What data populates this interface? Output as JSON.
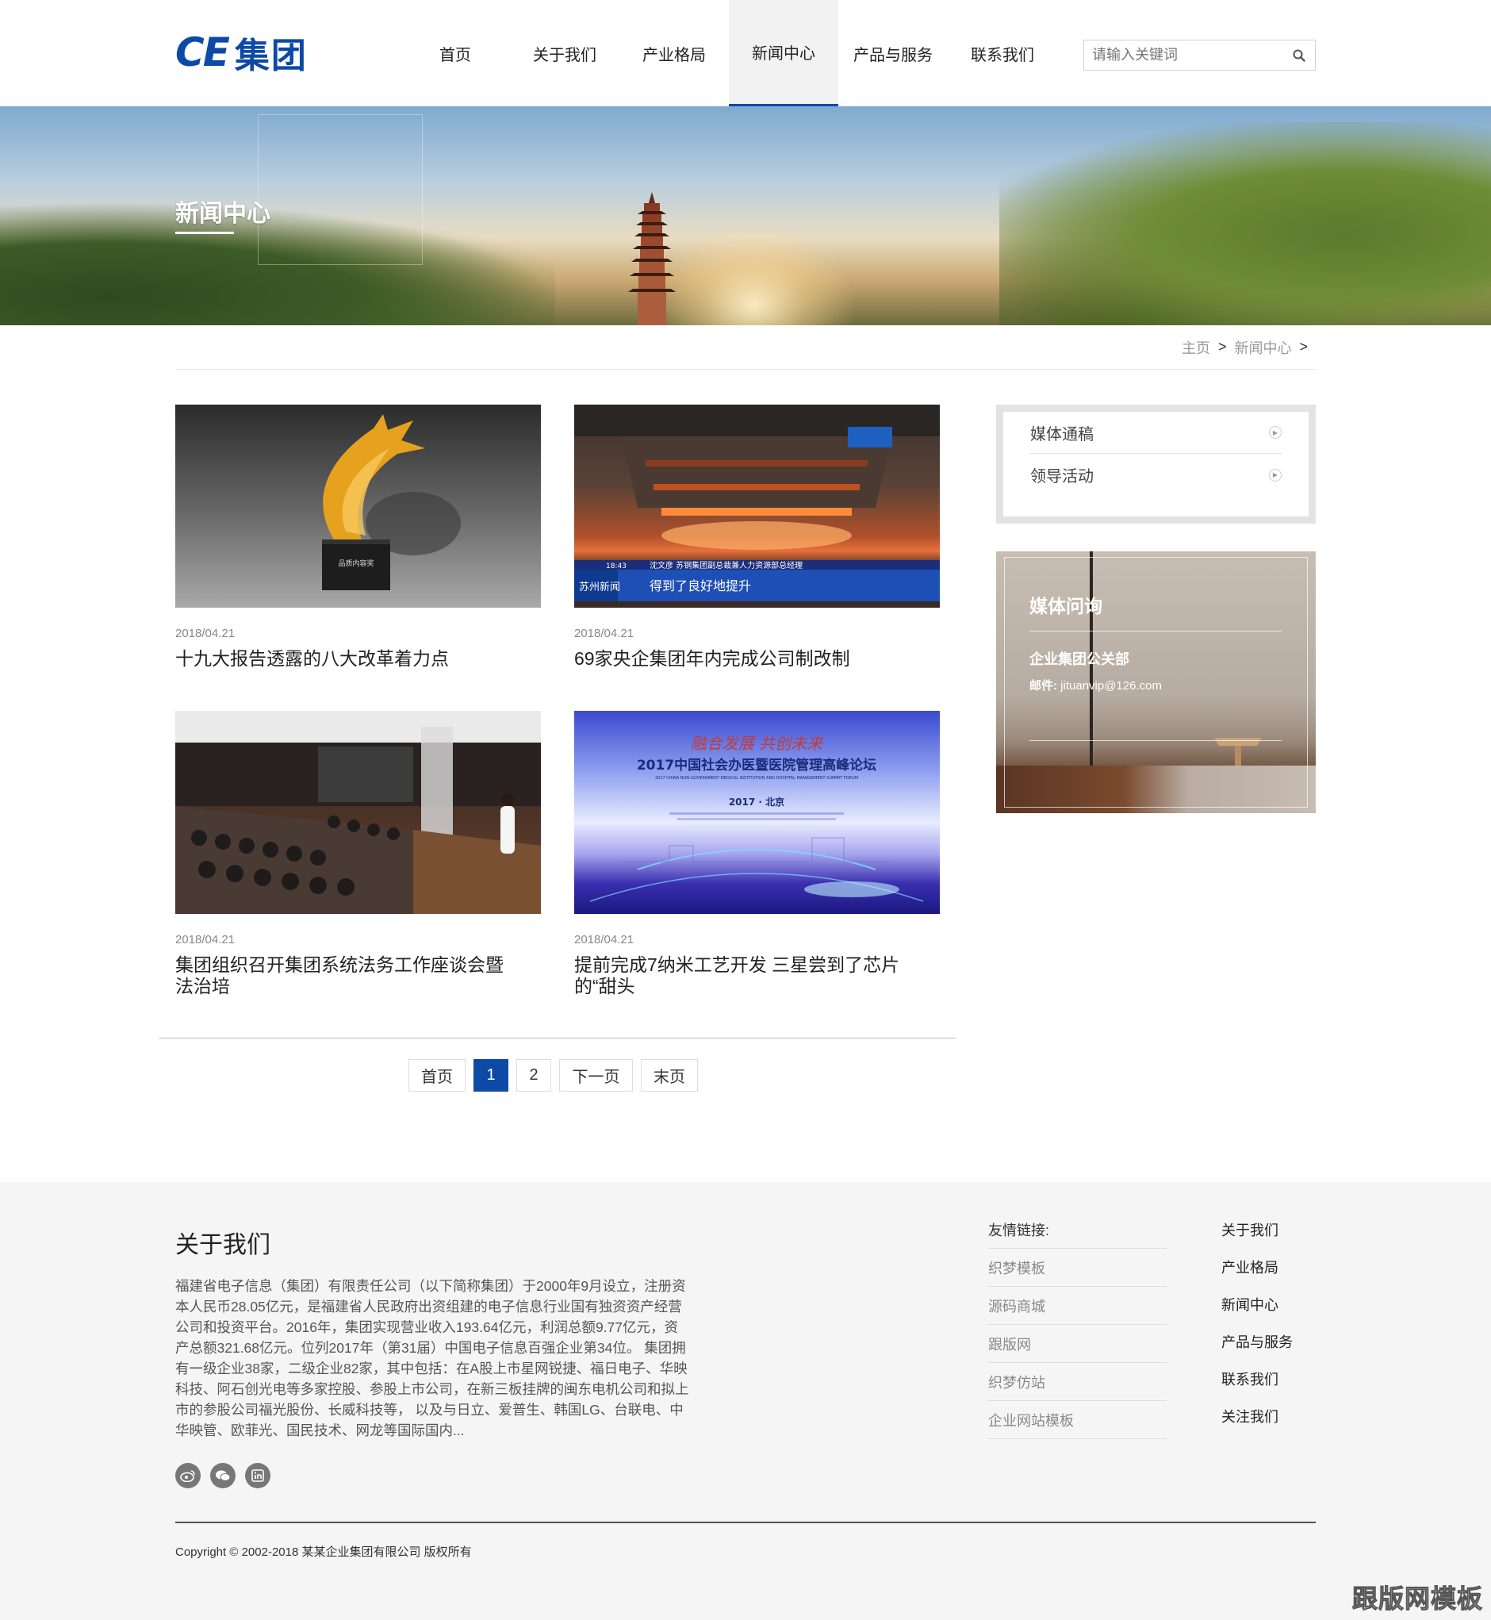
{
  "header": {
    "logo_ce": "CE",
    "logo_cn": "集团",
    "nav": [
      "首页",
      "关于我们",
      "产业格局",
      "新闻中心",
      "产品与服务",
      "联系我们"
    ],
    "active_nav": "新闻中心",
    "search_placeholder": "请输入关键词"
  },
  "banner": {
    "title": "新闻中心"
  },
  "breadcrumb": {
    "home": "主页",
    "sep1": ">",
    "current": "新闻中心",
    "sep2": ">"
  },
  "news": [
    {
      "date": "2018/04.21",
      "title": "十九大报告透露的八大改革着力点",
      "trophy_text": "品质内容奖"
    },
    {
      "date": "2018/04.21",
      "title": "69家央企集团年内完成公司制改制",
      "tv_ticker": "沈文彦  苏钢集团副总裁兼人力资源部总经理",
      "tv_caption": "得到了良好地提升",
      "tv_channel": "苏州新闻",
      "tv_time": "18:43"
    },
    {
      "date": "2018/04.21",
      "title": "集团组织召开集团系统法务工作座谈会暨法治培"
    },
    {
      "date": "2018/04.21",
      "title": "提前完成7纳米工艺开发 三星尝到了芯片的“甜头",
      "forum_slogan": "融合发展 共创未来",
      "forum_title": "2017中国社会办医暨医院管理高峰论坛",
      "forum_subtitle": "2017 CHINA NON-GOVERNMENT MEDICAL INSTITUTION AND HOSPITAL MANAGEMENT SUMMIT FORUM",
      "forum_place": "2017 · 北京"
    }
  ],
  "pager": {
    "first": "首页",
    "p1": "1",
    "p2": "2",
    "next": "下一页",
    "last": "末页"
  },
  "sidebar": {
    "categories": [
      "媒体通稿",
      "领导活动"
    ],
    "media_title": "媒体问询",
    "media_dept": "企业集团公关部",
    "media_mail_label": "邮件:",
    "media_mail": "jituanvip@126.com"
  },
  "footer": {
    "about_title": "关于我们",
    "about_text": "福建省电子信息（集团）有限责任公司（以下简称集团）于2000年9月设立，注册资本人民币28.05亿元，是福建省人民政府出资组建的电子信息行业国有独资资产经营公司和投资平台。2016年，集团实现营业收入193.64亿元，利润总额9.77亿元，资产总额321.68亿元。位列2017年（第31届）中国电子信息百强企业第34位。 集团拥有一级企业38家，二级企业82家，其中包括：在A股上市星网锐捷、福日电子、华映科技、阿石创光电等多家控股、参股上市公司，在新三板挂牌的闽东电机公司和拟上市的参股公司福光股份、长威科技等， 以及与日立、爱普生、韩国LG、台联电、中华映管、欧菲光、国民技术、网龙等国际国内...",
    "links_title": "友情链接:",
    "links": [
      "织梦模板",
      "源码商城",
      "跟版网",
      "织梦仿站",
      "企业网站模板"
    ],
    "nav": [
      "关于我们",
      "产业格局",
      "新闻中心",
      "产品与服务",
      "联系我们",
      "关注我们"
    ],
    "copyright": "Copyright © 2002-2018 某某企业集团有限公司 版权所有",
    "watermark": "跟版网模板"
  },
  "colors": {
    "brand": "#0c4aa6",
    "footer_bg": "#f5f5f5"
  }
}
